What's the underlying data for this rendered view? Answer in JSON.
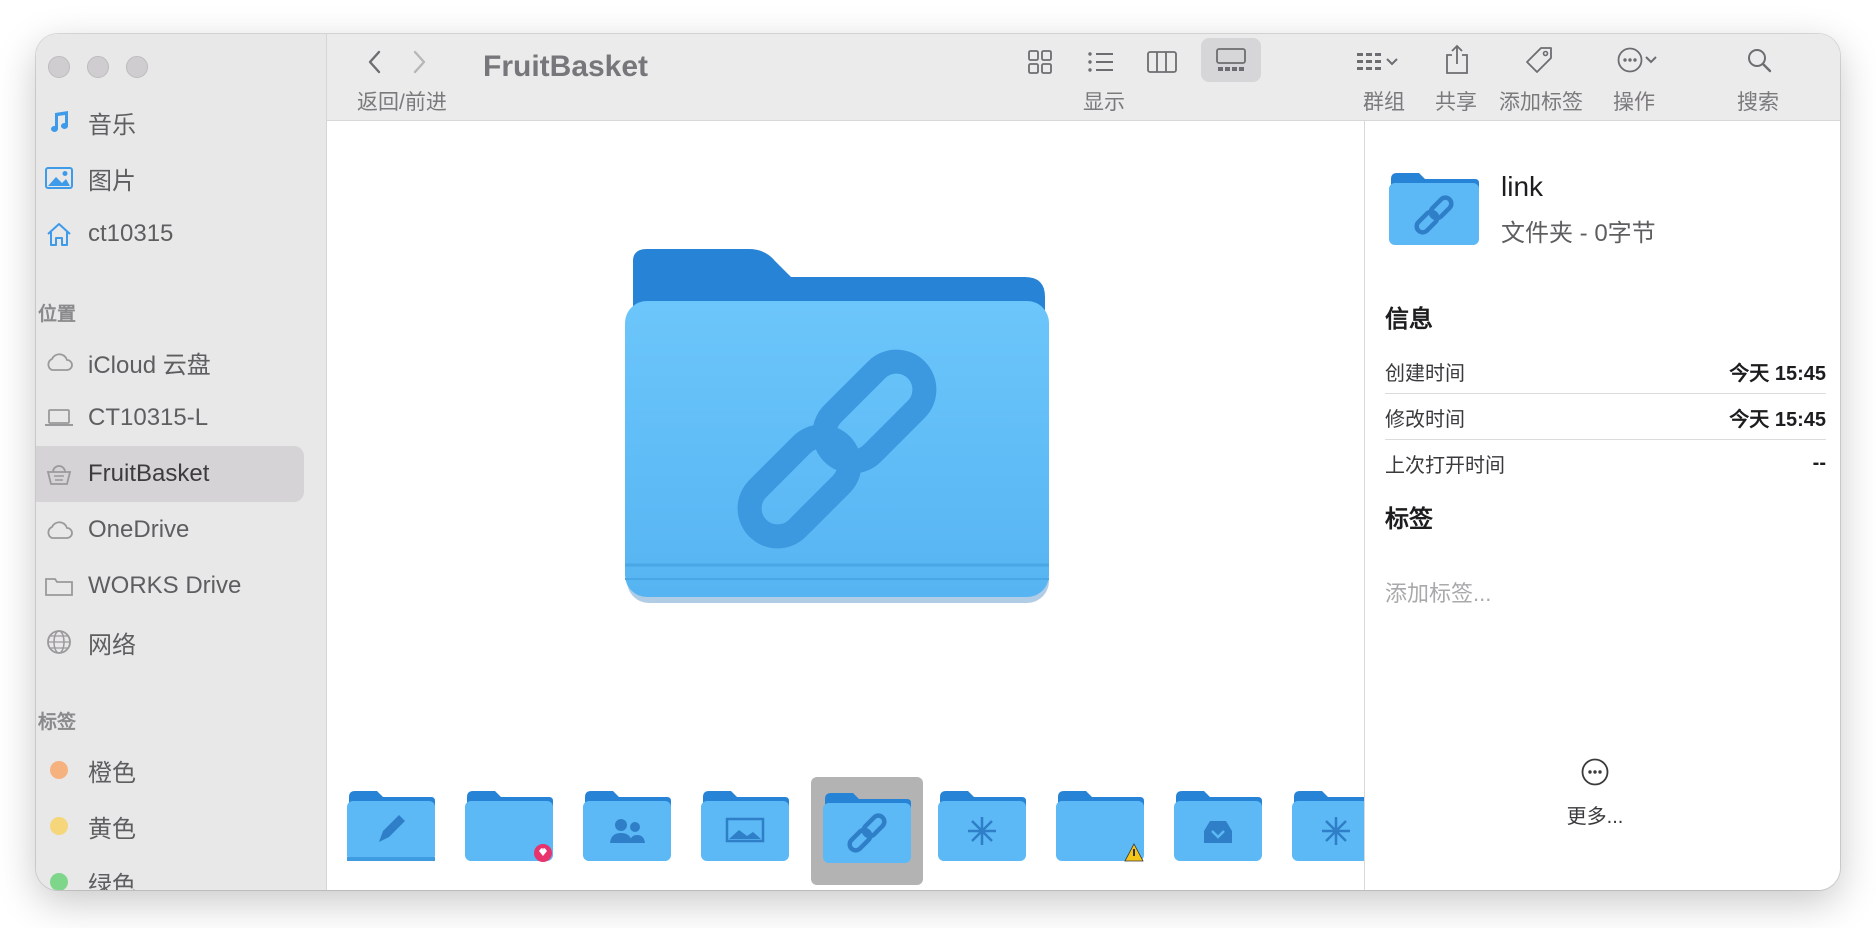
{
  "window": {
    "title": "FruitBasket"
  },
  "sidebar": {
    "favorites": [
      {
        "label": "音乐",
        "icon": "music-note-icon"
      },
      {
        "label": "图片",
        "icon": "photo-icon"
      },
      {
        "label": "ct10315",
        "icon": "home-icon"
      }
    ],
    "locations_header": "位置",
    "locations": [
      {
        "label": "iCloud 云盘",
        "icon": "cloud-icon"
      },
      {
        "label": "CT10315-L",
        "icon": "laptop-icon"
      },
      {
        "label": "FruitBasket",
        "icon": "basket-icon",
        "selected": true
      },
      {
        "label": "OneDrive",
        "icon": "cloud-icon"
      },
      {
        "label": "WORKS Drive",
        "icon": "folder-icon"
      },
      {
        "label": "网络",
        "icon": "globe-icon"
      }
    ],
    "tags_header": "标签",
    "tags": [
      {
        "label": "橙色",
        "color": "#f5b27e"
      },
      {
        "label": "黄色",
        "color": "#f5d67a"
      },
      {
        "label": "绿色",
        "color": "#7ed68a"
      }
    ]
  },
  "toolbar": {
    "back_forward_label": "返回/前进",
    "view_label": "显示",
    "group_label": "群组",
    "share_label": "共享",
    "tag_label": "添加标签",
    "action_label": "操作",
    "search_label": "搜索"
  },
  "gallery": {
    "thumbnails": [
      {
        "icon": "pencil-icon"
      },
      {
        "icon": "heart-badge-icon",
        "badge": "#e8336d"
      },
      {
        "icon": "people-icon"
      },
      {
        "icon": "picture-icon"
      },
      {
        "icon": "link-icon",
        "selected": true
      },
      {
        "icon": "sparkle-icon"
      },
      {
        "icon": "warning-badge-icon",
        "badge": "#f5c518"
      },
      {
        "icon": "inbox-icon"
      },
      {
        "icon": "sparkle-icon"
      }
    ]
  },
  "inspector": {
    "name": "link",
    "kind": "文件夹 - 0字节",
    "info_header": "信息",
    "rows": [
      {
        "key": "创建时间",
        "value": "今天 15:45"
      },
      {
        "key": "修改时间",
        "value": "今天 15:45"
      },
      {
        "key": "上次打开时间",
        "value": "--"
      }
    ],
    "tags_header": "标签",
    "tags_placeholder": "添加标签...",
    "more_label": "更多..."
  },
  "colors": {
    "folder_light": "#64c0f7",
    "folder_dark": "#2f8fdc",
    "accent": "#3d9be9"
  }
}
